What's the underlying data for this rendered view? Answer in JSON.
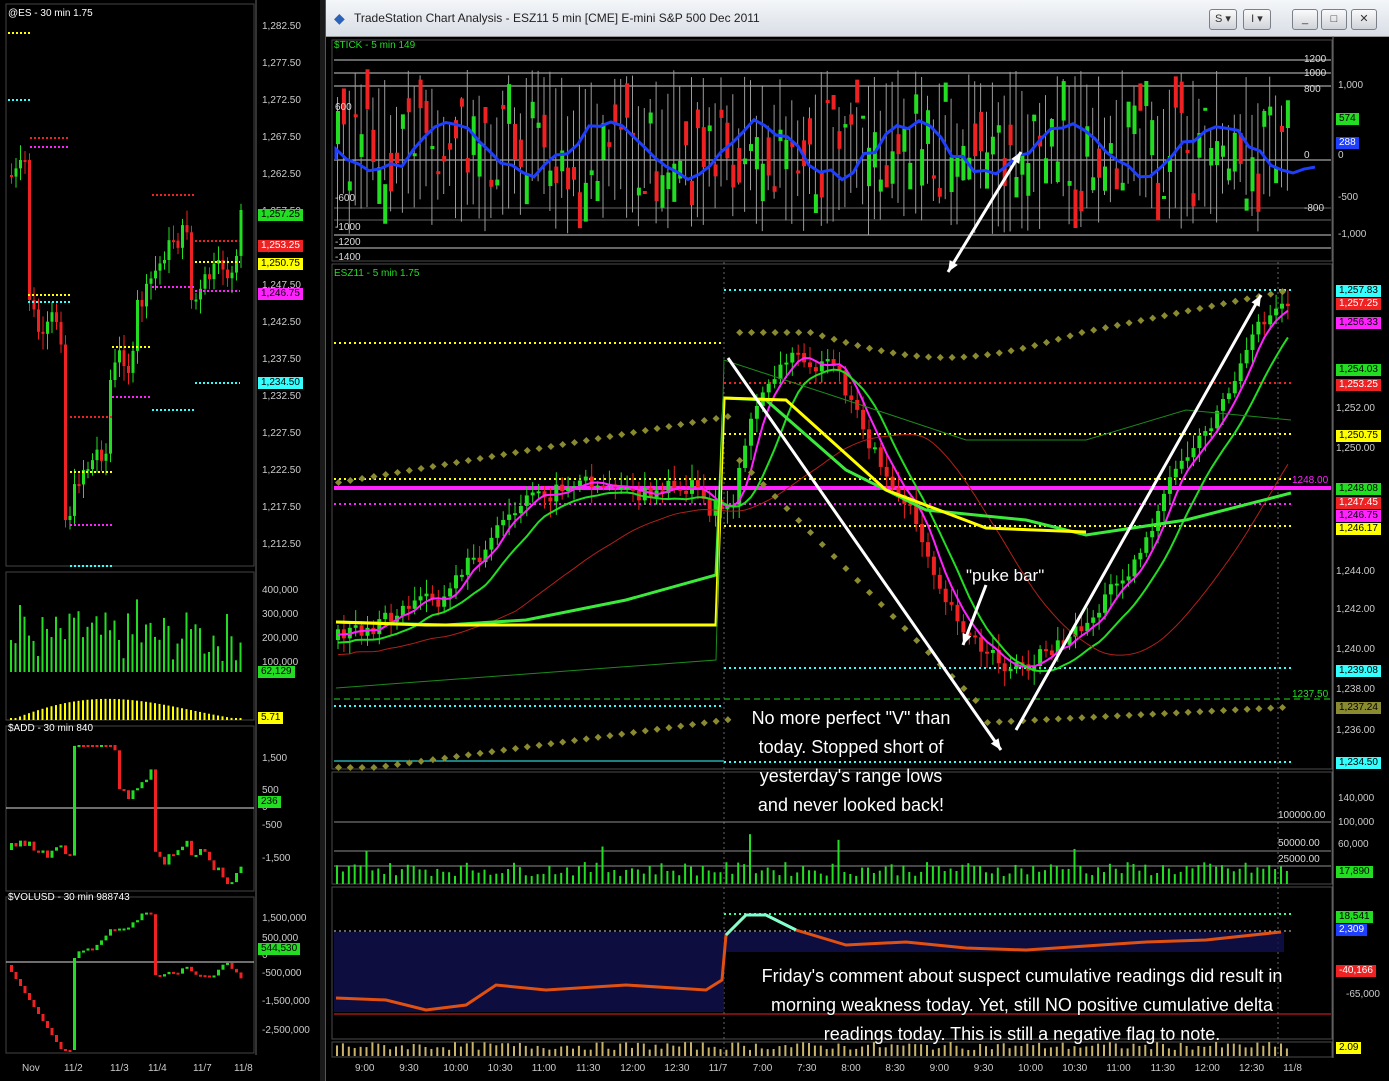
{
  "window": {
    "title": "TradeStation Chart Analysis - ESZ11 5 min [CME] E-mini S&P 500 Dec 2011",
    "buttons": [
      "S",
      "I",
      "_",
      "□",
      "✕"
    ]
  },
  "left": {
    "es_label": "@ES - 30 min  1.75",
    "add_label": "$ADD - 30 min  840",
    "volusd_label": "$VOLUSD - 30 min  988743",
    "price_axis": [
      "1,282.50",
      "1,277.50",
      "1,272.50",
      "1,267.50",
      "1,262.50",
      "1,257.50",
      "1,252.50",
      "1,247.50",
      "1,242.50",
      "1,237.50",
      "1,232.50",
      "1,227.50",
      "1,222.50",
      "1,217.50",
      "1,212.50"
    ],
    "vol_axis": [
      "400,000",
      "300,000",
      "200,000",
      "100,000"
    ],
    "add_axis": [
      "1,500",
      "500",
      "0",
      "-500",
      "-1,500"
    ],
    "volusd_axis": [
      "1,500,000",
      "500,000",
      "0",
      "-500,000",
      "-1,500,000",
      "-2,500,000"
    ],
    "tags": {
      "t1": "1,257.25",
      "t2": "1,253.25",
      "t3": "1,250.75",
      "t4": "1,246.75",
      "t5": "1,234.50",
      "vol": "62,129",
      "osc": "5.71",
      "add": "236",
      "volusd": "544,530"
    },
    "dates": [
      "Nov",
      "11/2",
      "11/3",
      "11/4",
      "11/7",
      "11/8"
    ]
  },
  "main": {
    "tick_label": "$TICK - 5 min  149",
    "es_label": "ESZ11 - 5 min  1.75",
    "tick_axis": [
      "1,000",
      "0",
      "-500",
      "-1,000"
    ],
    "tick_levels": [
      "1200",
      "1000",
      "800",
      "0",
      "-800"
    ],
    "tick_left_levels": [
      "600",
      "-600",
      "-1000",
      "-1200",
      "-1400"
    ],
    "tick_tags": {
      "t1": "574",
      "t2": "288"
    },
    "price_axis": [
      "1,252.00",
      "1,250.00",
      "1,244.00",
      "1,242.00",
      "1,240.00",
      "1,238.00",
      "1,236.00"
    ],
    "price_tags": {
      "a": "1,257.83",
      "b": "1,257.25",
      "c": "1,256.33",
      "d": "1,254.03",
      "e": "1,253.25",
      "f": "1,250.75",
      "g": "1,248.08",
      "h": "1,247.45",
      "i": "1,246.75",
      "j": "1,246.17",
      "k": "1,239.08",
      "l": "1,237.24",
      "m": "1,234.50"
    },
    "level_1248": "1248.00",
    "level_1237": "1237.50",
    "puke_label": "\"puke bar\"",
    "note1": [
      "No more perfect \"V\" than",
      "today.  Stopped short of",
      "yesterday's range lows",
      "and never looked back!"
    ],
    "vol_axis": [
      "140,000",
      "100,000",
      "60,000"
    ],
    "vol_levels": [
      "100000.00",
      "50000.00",
      "25000.00"
    ],
    "vol_tag": "17,890",
    "delta_axis": [
      "-65,000"
    ],
    "delta_tags": {
      "a": "18,541",
      "b": "2,309",
      "c": "-40,166"
    },
    "osc_tag": "2.09",
    "note2": [
      "Friday's comment about suspect cumulative readings did result in",
      "morning weakness today.  Yet, still NO positive cumulative delta",
      "readings today.  This is still a negative flag to note."
    ],
    "time_axis": [
      "9:00",
      "9:30",
      "10:00",
      "10:30",
      "11:00",
      "11:30",
      "12:00",
      "12:30",
      "11/7",
      "7:00",
      "7:30",
      "8:00",
      "8:30",
      "9:00",
      "9:30",
      "10:00",
      "10:30",
      "11:00",
      "11:30",
      "12:00",
      "12:30",
      "11/8"
    ]
  },
  "colors": {
    "green": "#22dd22",
    "red": "#ee2222",
    "yellow": "#ffff00",
    "magenta": "#ff22ff",
    "cyan": "#33ffff",
    "blue": "#1f3fff",
    "olive": "#8a8a30",
    "gray": "#aaaaaa"
  }
}
